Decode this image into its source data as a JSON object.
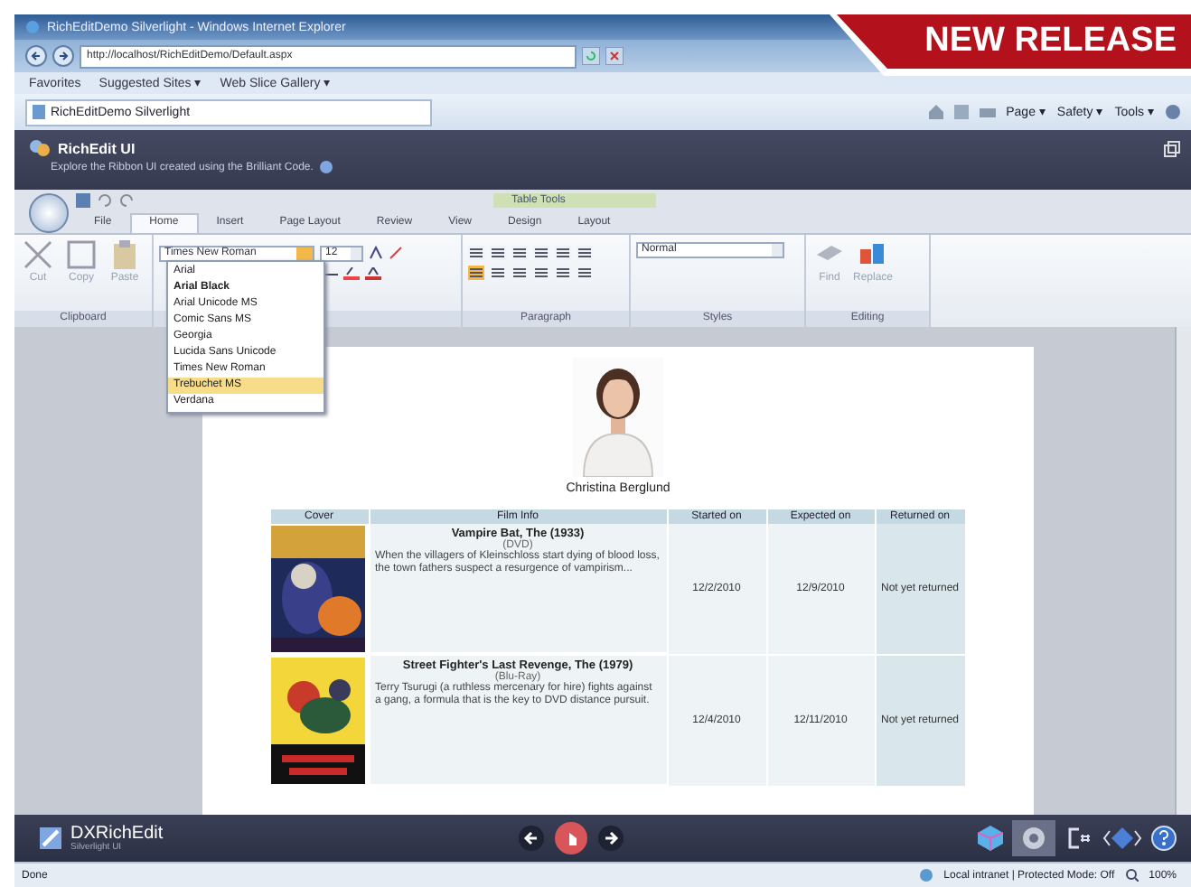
{
  "banner": {
    "text": "**NEW** RELEASE"
  },
  "browser": {
    "title": "RichEditDemo Silverlight - Windows Internet Explorer",
    "address": "http://localhost/RichEditDemo/Default.aspx",
    "favorites": [
      "Favorites",
      "Suggested Sites ▾",
      "Web Slice Gallery ▾"
    ],
    "tab": "RichEditDemo Silverlight",
    "commands": [
      "Page ▾",
      "Safety ▾",
      "Tools ▾"
    ]
  },
  "app": {
    "title": "RichEdit UI",
    "subtitle": "Explore the Ribbon UI created using the Brilliant Code."
  },
  "ribbon": {
    "contextual": "Table Tools",
    "tabs": [
      {
        "label": "File",
        "selected": false
      },
      {
        "label": "Home",
        "selected": true
      },
      {
        "label": "Insert",
        "selected": false
      },
      {
        "label": "Page Layout",
        "selected": false
      },
      {
        "label": "Review",
        "selected": false
      },
      {
        "label": "View",
        "selected": false
      },
      {
        "label": "Design",
        "selected": false
      },
      {
        "label": "Layout",
        "selected": false
      }
    ],
    "clipboard": [
      "Cut",
      "Copy",
      "Paste"
    ],
    "font": "Times New Roman",
    "size": "12",
    "style": "Normal",
    "editing": [
      "Find",
      "Replace"
    ],
    "groups": [
      "Clipboard",
      "Paragraph",
      "Styles",
      "Editing"
    ],
    "font_list": [
      {
        "label": "Arial",
        "bold": false,
        "selected": false
      },
      {
        "label": "Arial Black",
        "bold": true,
        "selected": false
      },
      {
        "label": "Arial Unicode MS",
        "bold": false,
        "selected": false
      },
      {
        "label": "Comic Sans MS",
        "bold": false,
        "selected": false
      },
      {
        "label": "Georgia",
        "bold": false,
        "selected": false
      },
      {
        "label": "Lucida Sans Unicode",
        "bold": false,
        "selected": false
      },
      {
        "label": "Times New Roman",
        "bold": false,
        "selected": false
      },
      {
        "label": "Trebuchet MS",
        "bold": false,
        "selected": true
      },
      {
        "label": "Verdana",
        "bold": false,
        "selected": false
      }
    ]
  },
  "document": {
    "name": "Christina Berglund",
    "columns": [
      "Cover",
      "Film Info",
      "Started on",
      "Expected on",
      "Returned on"
    ],
    "rows": [
      {
        "title": "Vampire Bat, The (1933)",
        "format": "(DVD)",
        "description": "When the villagers of Kleinschloss start dying of blood loss, the town fathers suspect a resurgence of vampirism...",
        "started": "12/2/2010",
        "expected": "12/9/2010",
        "returned": "Not yet returned"
      },
      {
        "title": "Street Fighter's Last Revenge, The (1979)",
        "format": "(Blu-Ray)",
        "description": "Terry Tsurugi (a ruthless mercenary for hire) fights against a gang, a formula that is the key to DVD distance pursuit.",
        "started": "12/4/2010",
        "expected": "12/11/2010",
        "returned": "Not yet returned"
      }
    ]
  },
  "footer": {
    "product": "DXRichEdit",
    "subtitle": "Silverlight UI"
  },
  "status": {
    "left": "Done",
    "zone": "Local intranet | Protected Mode: Off",
    "zoom": "100%"
  }
}
